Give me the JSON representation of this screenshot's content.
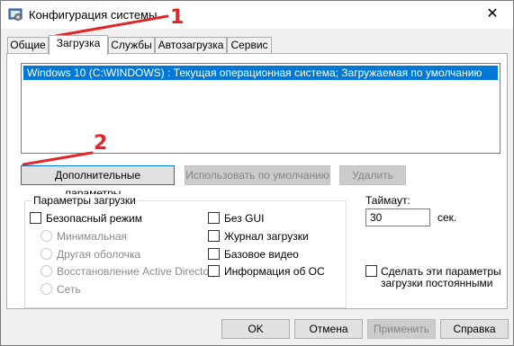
{
  "window": {
    "title": "Конфигурация системы",
    "icon": "msconfig-icon",
    "close": "✕"
  },
  "tabs": [
    {
      "label": "Общие",
      "active": false
    },
    {
      "label": "Загрузка",
      "active": true
    },
    {
      "label": "Службы",
      "active": false
    },
    {
      "label": "Автозагрузка",
      "active": false
    },
    {
      "label": "Сервис",
      "active": false
    }
  ],
  "os_list": {
    "items": [
      "Windows 10 (C:\\WINDOWS) : Текущая операционная система; Загружаемая по умолчанию ОС"
    ],
    "selected_index": 0
  },
  "list_buttons": {
    "advanced": "Дополнительные параметры...",
    "set_default": "Использовать по умолчанию",
    "delete": "Удалить"
  },
  "boot_options": {
    "group_label": "Параметры загрузки",
    "safe_boot": {
      "label": "Безопасный режим",
      "checked": false
    },
    "safe_modes": [
      {
        "label": "Минимальная",
        "enabled": false
      },
      {
        "label": "Другая оболочка",
        "enabled": false
      },
      {
        "label": "Восстановление Active Directory",
        "enabled": false
      },
      {
        "label": "Сеть",
        "enabled": false
      }
    ],
    "flags": [
      {
        "label": "Без GUI",
        "checked": false
      },
      {
        "label": "Журнал загрузки",
        "checked": false
      },
      {
        "label": "Базовое видео",
        "checked": false
      },
      {
        "label": "Информация  об ОС",
        "checked": false
      }
    ]
  },
  "timeout": {
    "label": "Таймаут:",
    "value": "30",
    "unit": "сек."
  },
  "permanent": {
    "label_line1": "Сделать эти параметры",
    "label_line2": "загрузки постоянными",
    "checked": false
  },
  "footer": {
    "ok": "OK",
    "cancel": "Отмена",
    "apply": "Применить",
    "help": "Справка"
  },
  "annotations": {
    "marker1": "1",
    "marker2": "2",
    "color": "#e0262b"
  },
  "colors": {
    "selection": "#0078d7",
    "window_bg": "#f0f0f0"
  }
}
